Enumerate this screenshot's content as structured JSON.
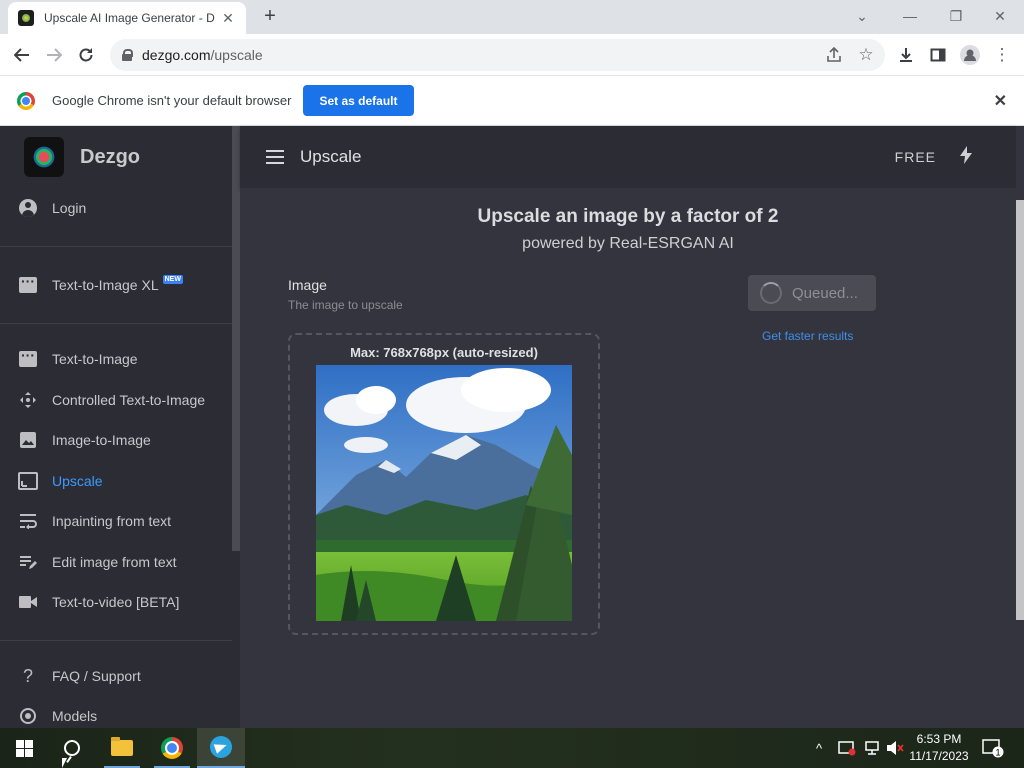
{
  "browser": {
    "tab_title": "Upscale AI Image Generator - D",
    "new_tab_glyph": "+",
    "url_domain": "dezgo.com",
    "url_path": "/upscale"
  },
  "infobar": {
    "message": "Google Chrome isn't your default browser",
    "button_label": "Set as default"
  },
  "sidebar": {
    "brand": "Dezgo",
    "login": "Login",
    "new_badge": "NEW",
    "items": [
      {
        "label": "Text-to-Image XL",
        "icon": "chat-icon"
      },
      {
        "label": "Text-to-Image",
        "icon": "chat-icon"
      },
      {
        "label": "Controlled Text-to-Image",
        "icon": "move-icon"
      },
      {
        "label": "Image-to-Image",
        "icon": "image-icon"
      },
      {
        "label": "Upscale",
        "icon": "upscale-icon",
        "active": true
      },
      {
        "label": "Inpainting from text",
        "icon": "wrap-text-icon"
      },
      {
        "label": "Edit image from text",
        "icon": "edit-note-icon"
      },
      {
        "label": "Text-to-video [BETA]",
        "icon": "video-icon"
      },
      {
        "label": "FAQ / Support",
        "icon": "help-icon"
      },
      {
        "label": "Models",
        "icon": "models-icon"
      }
    ]
  },
  "appbar": {
    "title": "Upscale",
    "plan": "FREE"
  },
  "main": {
    "heading": "Upscale an image by a factor of 2",
    "subheading": "powered by Real-ESRGAN AI",
    "field_label": "Image",
    "field_hint": "The image to upscale",
    "max_text": "Max: 768x768px (auto-resized)",
    "queued_label": "Queued...",
    "faster_link": "Get faster results"
  },
  "taskbar": {
    "time": "6:53 PM",
    "date": "11/17/2023",
    "notification_count": "1"
  },
  "colors": {
    "accent": "#3d9bff",
    "sidebar_bg": "#2b2c34",
    "main_bg": "#33343d",
    "chrome_blue": "#1a73e8"
  }
}
